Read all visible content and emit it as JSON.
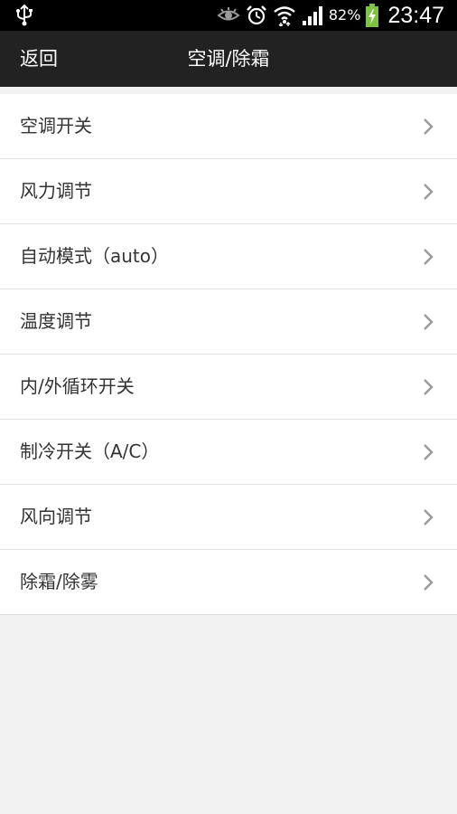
{
  "status_bar": {
    "battery_percent": "82%",
    "time": "23:47",
    "icons": [
      "usb-icon",
      "eye-icon",
      "alarm-icon",
      "wifi-icon",
      "signal-icon",
      "battery-charging-icon"
    ]
  },
  "header": {
    "back_label": "返回",
    "title": "空调/除霜"
  },
  "menu": {
    "items": [
      {
        "label": "空调开关"
      },
      {
        "label": "风力调节"
      },
      {
        "label": "自动模式（auto）"
      },
      {
        "label": "温度调节"
      },
      {
        "label": "内/外循环开关"
      },
      {
        "label": "制冷开关（A/C）"
      },
      {
        "label": "风向调节"
      },
      {
        "label": "除霜/除雾"
      }
    ]
  },
  "colors": {
    "status_bar_bg": "#000000",
    "action_bar_bg": "#222222",
    "page_bg": "#f2f2f2",
    "list_bg": "#ffffff",
    "battery_green": "#7dc242"
  }
}
